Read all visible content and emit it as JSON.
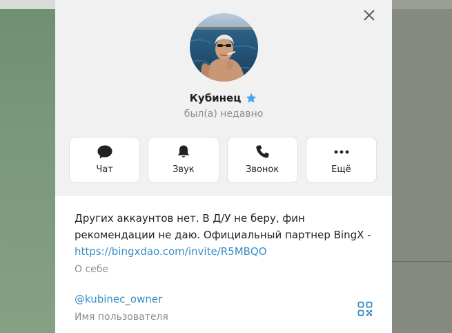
{
  "profile": {
    "name": "Кубинец",
    "status": "был(а) недавно"
  },
  "actions": [
    {
      "label": "Чат",
      "icon": "chat-bubble-icon"
    },
    {
      "label": "Звук",
      "icon": "bell-icon"
    },
    {
      "label": "Звонок",
      "icon": "phone-icon"
    },
    {
      "label": "Ещё",
      "icon": "more-dots-icon"
    }
  ],
  "about": {
    "text": "Других аккаунтов нет. В Д/У не беру, фин рекомендации не даю. Официальный партнер BingX -",
    "link": "https://bingxdao.com/invite/R5MBQO",
    "label": "О себе"
  },
  "username": {
    "value": "@kubinec_owner",
    "label": "Имя пользователя"
  },
  "colors": {
    "accent": "#3a8cc6",
    "star": "#4aa3e8",
    "muted": "#8d8d8d"
  }
}
